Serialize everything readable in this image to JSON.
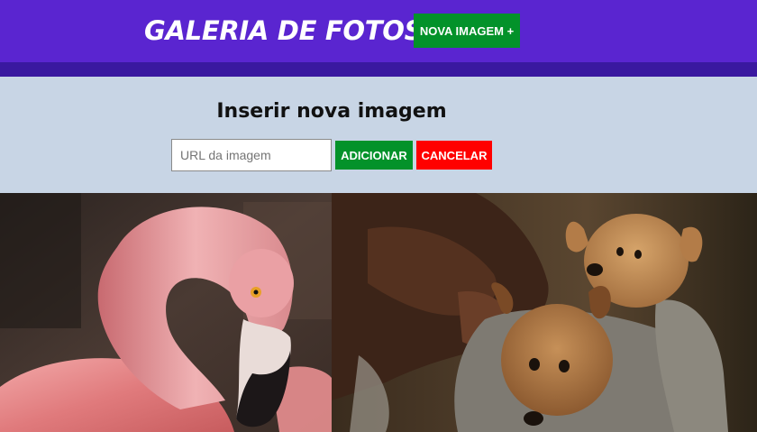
{
  "header": {
    "title": "GALERIA DE FOTOS",
    "new_image_label": "NOVA IMAGEM +"
  },
  "form": {
    "title": "Inserir nova imagem",
    "url_placeholder": "URL da imagem",
    "url_value": "",
    "add_label": "ADICIONAR",
    "cancel_label": "CANCELAR"
  },
  "gallery": {
    "images": [
      {
        "subject": "flamingo"
      },
      {
        "subject": "puppies"
      }
    ]
  },
  "colors": {
    "header": "#5a25d0",
    "header_bar": "#3a18a0",
    "form_background": "#c8d5e5",
    "success": "#03922a",
    "danger": "#ff0000"
  }
}
